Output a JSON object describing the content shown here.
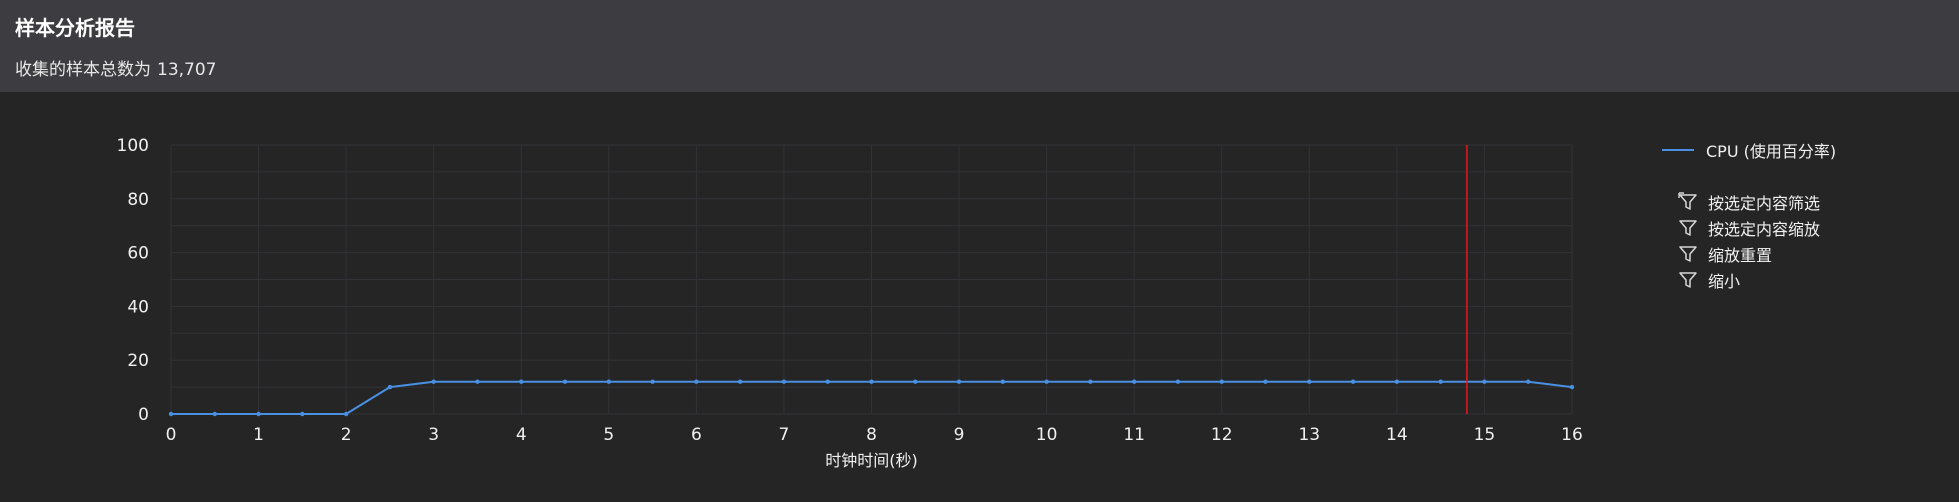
{
  "header": {
    "title": "样本分析报告",
    "subtitle_prefix": "收集的样本总数为",
    "sample_count": "13,707"
  },
  "legend": {
    "series_label": "CPU (使用百分率)",
    "actions": [
      {
        "label": "按选定内容筛选",
        "icon": "filter-select-icon"
      },
      {
        "label": "按选定内容缩放",
        "icon": "filter-zoom-icon"
      },
      {
        "label": "缩放重置",
        "icon": "filter-reset-icon"
      },
      {
        "label": "缩小",
        "icon": "filter-zoom-out-icon"
      }
    ]
  },
  "colors": {
    "header_bg": "#3c3c41",
    "chart_bg": "#252526",
    "series_line": "#4a90e2",
    "cursor_line": "#e0191f",
    "grid": "#333337"
  },
  "chart_data": {
    "type": "line",
    "title": "",
    "xlabel": "时钟时间(秒)",
    "ylabel": "",
    "xlim": [
      0,
      16
    ],
    "ylim": [
      0,
      100
    ],
    "x_ticks": [
      "0",
      "1",
      "2",
      "3",
      "4",
      "5",
      "6",
      "7",
      "8",
      "9",
      "10",
      "11",
      "12",
      "13",
      "14",
      "15",
      "16"
    ],
    "y_ticks": [
      "0",
      "20",
      "40",
      "60",
      "80",
      "100"
    ],
    "grid": true,
    "legend_position": "right",
    "cursor_x": 14.8,
    "series": [
      {
        "name": "CPU (使用百分率)",
        "x": [
          0,
          0.5,
          1,
          1.5,
          2,
          2.5,
          3,
          3.5,
          4,
          4.5,
          5,
          5.5,
          6,
          6.5,
          7,
          7.5,
          8,
          8.5,
          9,
          9.5,
          10,
          10.5,
          11,
          11.5,
          12,
          12.5,
          13,
          13.5,
          14,
          14.5,
          15,
          15.5,
          16
        ],
        "y": [
          0,
          0,
          0,
          0,
          0,
          10,
          12,
          12,
          12,
          12,
          12,
          12,
          12,
          12,
          12,
          12,
          12,
          12,
          12,
          12,
          12,
          12,
          12,
          12,
          12,
          12,
          12,
          12,
          12,
          12,
          12,
          12,
          10
        ]
      }
    ]
  }
}
